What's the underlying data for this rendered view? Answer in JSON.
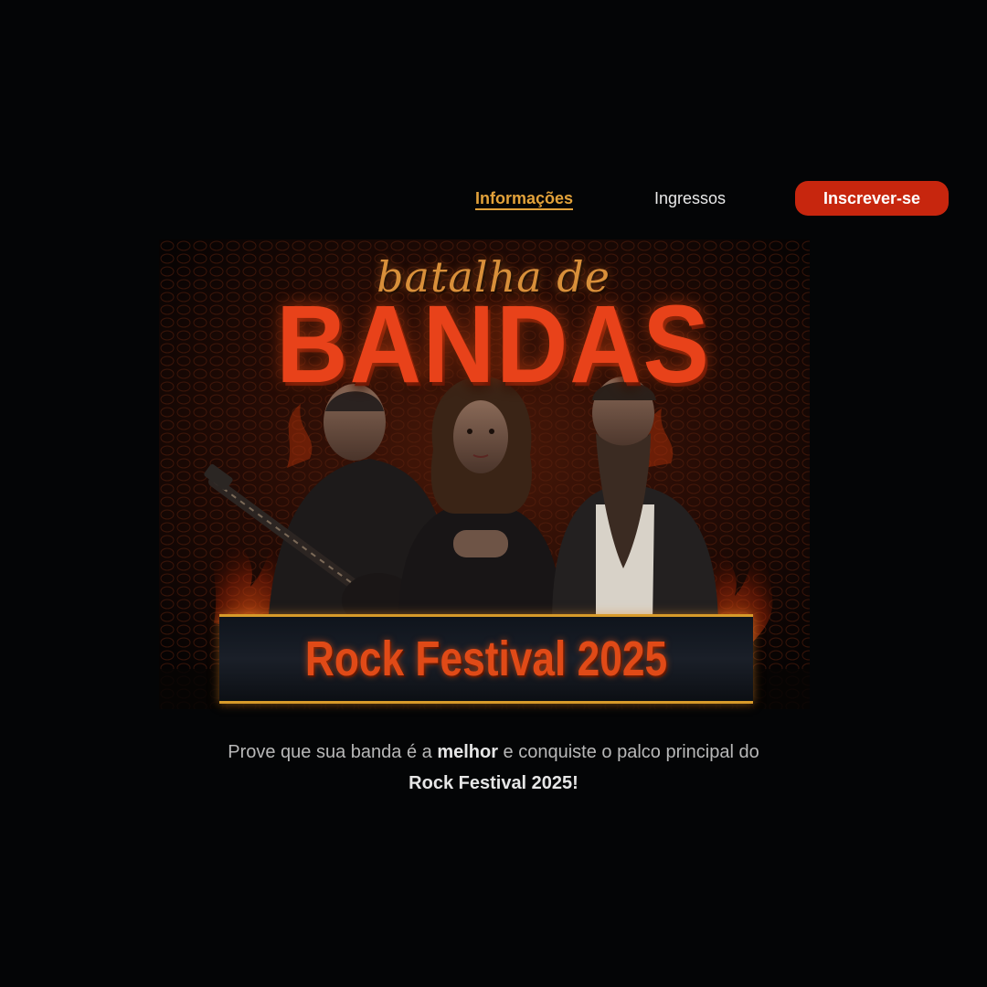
{
  "nav": {
    "info_label": "Informações",
    "tickets_label": "Ingressos",
    "signup_label": "Inscrever-se"
  },
  "banner": {
    "script_title": "batalha de",
    "headline": "BANDAS",
    "festival_label": "Rock Festival 2025"
  },
  "description": {
    "part1": "Prove que sua banda é a ",
    "highlight1": "melhor",
    "part2": " e conquiste o palco principal do",
    "highlight2": "Rock Festival 2025!"
  },
  "colors": {
    "background": "#040506",
    "accent_gold": "#e3a23a",
    "cta_red": "#c7260e",
    "headline_red": "#e8421a"
  }
}
